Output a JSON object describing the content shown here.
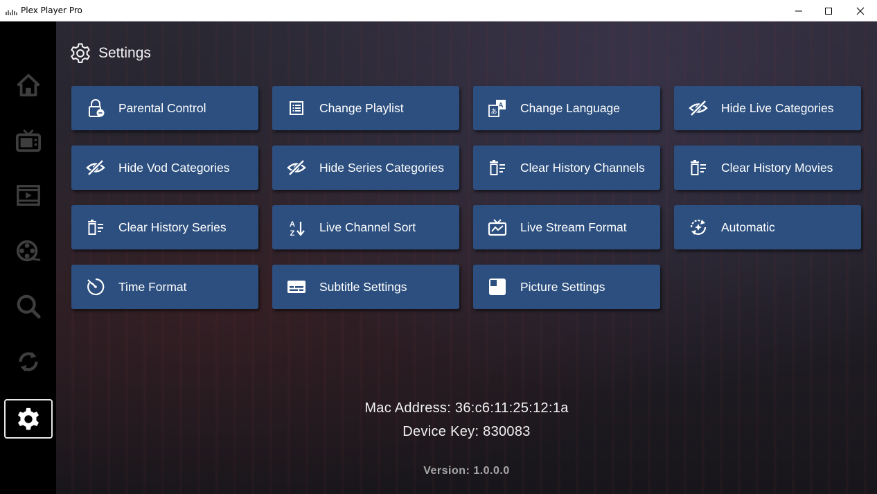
{
  "window": {
    "title": "Plex Player Pro",
    "controls": [
      "minimize-icon",
      "maximize-icon",
      "close-icon"
    ]
  },
  "sidebar": {
    "items": [
      {
        "icon": "home-icon",
        "active": false
      },
      {
        "icon": "tv-icon",
        "active": false
      },
      {
        "icon": "movie-icon",
        "active": false
      },
      {
        "icon": "film-reel-icon",
        "active": false
      },
      {
        "icon": "search-icon",
        "active": false
      },
      {
        "icon": "refresh-icon",
        "active": false
      },
      {
        "icon": "gear-icon",
        "active": true
      }
    ]
  },
  "header": {
    "icon": "gear-icon",
    "title": "Settings"
  },
  "settings": [
    {
      "label": "Parental Control",
      "icon": "lock-icon"
    },
    {
      "label": "Change Playlist",
      "icon": "list-icon"
    },
    {
      "label": "Change Language",
      "icon": "translate-icon"
    },
    {
      "label": "Hide Live Categories",
      "icon": "eye-off-icon"
    },
    {
      "label": "Hide Vod Categories",
      "icon": "eye-off-icon"
    },
    {
      "label": "Hide Series Categories",
      "icon": "eye-off-icon"
    },
    {
      "label": "Clear History Channels",
      "icon": "clear-list-icon"
    },
    {
      "label": "Clear History Movies",
      "icon": "clear-list-icon"
    },
    {
      "label": "Clear History Series",
      "icon": "clear-list-icon"
    },
    {
      "label": "Live Channel Sort",
      "icon": "sort-az-icon"
    },
    {
      "label": "Live Stream Format",
      "icon": "tv-stream-icon"
    },
    {
      "label": "Automatic",
      "icon": "auto-refresh-icon"
    },
    {
      "label": "Time Format",
      "icon": "timer-icon"
    },
    {
      "label": "Subtitle Settings",
      "icon": "subtitles-icon"
    },
    {
      "label": "Picture Settings",
      "icon": "picture-icon"
    }
  ],
  "device": {
    "mac": "Mac Address: 36:c6:11:25:12:1a",
    "key": "Device Key: 830083",
    "version": "Version: 1.0.0.0"
  },
  "colors": {
    "tile": "#2c4f7f",
    "sidebar": "#000000",
    "text": "#ffffff",
    "nav_icon": "#3a3a3a"
  }
}
